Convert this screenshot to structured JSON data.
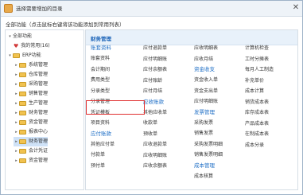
{
  "window": {
    "title": "选择需要增加的目录"
  },
  "hint": "全部功能（点击鼠标右键将该功能添加到常用列表）",
  "tree": {
    "root": "全部功能",
    "favorites": "我的常用(16)",
    "erp": "ERP功能",
    "items": [
      "系统管理",
      "仓库管理",
      "采购管理",
      "销售管理",
      "生产管理",
      "财务管理",
      "资金管理",
      "报表中心",
      "财务管理",
      "会计凭证",
      "资金管理"
    ]
  },
  "panel": {
    "title": "财务管理",
    "columns": [
      {
        "entries": [
          {
            "text": "账套资料",
            "cat": true
          },
          {
            "text": "账套资料"
          },
          {
            "text": "会计期间"
          },
          {
            "text": "费用类型"
          },
          {
            "text": "分录类型"
          },
          {
            "text": "分录管理"
          },
          {
            "text": "凭证模板"
          },
          {
            "text": "项目资料"
          },
          {
            "text": "应付账款",
            "cat": true
          },
          {
            "text": "其他应付单"
          },
          {
            "text": "付款单"
          },
          {
            "text": "预付单"
          }
        ]
      },
      {
        "entries": [
          {
            "text": "应付退款单"
          },
          {
            "text": "应付明细账"
          },
          {
            "text": "应付余额表"
          },
          {
            "text": "应付账龄"
          },
          {
            "text": "应付月结"
          },
          {
            "text": "应收账款",
            "cat": true
          },
          {
            "text": "其他应收单"
          },
          {
            "text": "收款单"
          },
          {
            "text": "预收单"
          },
          {
            "text": "应收退款单"
          },
          {
            "text": "应收明细账"
          },
          {
            "text": "应收余额表"
          }
        ]
      },
      {
        "entries": [
          {
            "text": "应收明细表"
          },
          {
            "text": "应收月结"
          },
          {
            "text": "资金收支",
            "cat": true
          },
          {
            "text": "资金收入单"
          },
          {
            "text": "资金支出单"
          },
          {
            "text": "应付明细账"
          },
          {
            "text": "发票管理",
            "cat": true
          },
          {
            "text": "采购发票"
          },
          {
            "text": "销售发票"
          },
          {
            "text": "采购发票明细"
          },
          {
            "text": "销售发票明细"
          },
          {
            "text": "成本管理",
            "cat": true
          },
          {
            "text": "成本核算"
          }
        ]
      },
      {
        "entries": [
          {
            "text": "计算机检查"
          },
          {
            "text": "工时分摊表"
          },
          {
            "text": "每月人工制造"
          },
          {
            "text": "补充单价"
          },
          {
            "text": "成本计算"
          },
          {
            "text": "销货成本表"
          },
          {
            "text": "库存成本表"
          },
          {
            "text": "产品成本表"
          },
          {
            "text": "在制成本表"
          },
          {
            "text": "成本分录"
          }
        ]
      }
    ]
  }
}
